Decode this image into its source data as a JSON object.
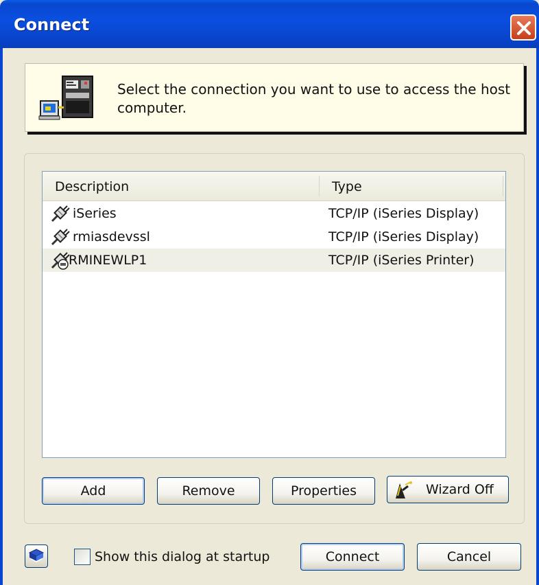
{
  "window": {
    "title": "Connect"
  },
  "banner": {
    "text": "Select the connection you want to use to access the host computer."
  },
  "list": {
    "columns": [
      "Description",
      "Type"
    ],
    "rows": [
      {
        "description": "iSeries",
        "type": "TCP/IP (iSeries Display)",
        "icon": "plug-icon",
        "selected": false
      },
      {
        "description": "rmiasdevssl",
        "type": "TCP/IP (iSeries Display)",
        "icon": "plug-icon",
        "selected": false
      },
      {
        "description": "RMINEWLP1",
        "type": "TCP/IP (iSeries Printer)",
        "icon": "plug-printer-icon",
        "selected": true
      }
    ]
  },
  "buttons": {
    "add": "Add",
    "remove": "Remove",
    "properties": "Properties",
    "wizard": "Wizard Off",
    "connect": "Connect",
    "cancel": "Cancel"
  },
  "startup": {
    "label": "Show this dialog at startup",
    "checked": false
  },
  "colors": {
    "titlebar": "#0a4fe0",
    "dialog_bg": "#ece9d8",
    "banner_bg": "#fffde7",
    "close": "#d6502d"
  }
}
